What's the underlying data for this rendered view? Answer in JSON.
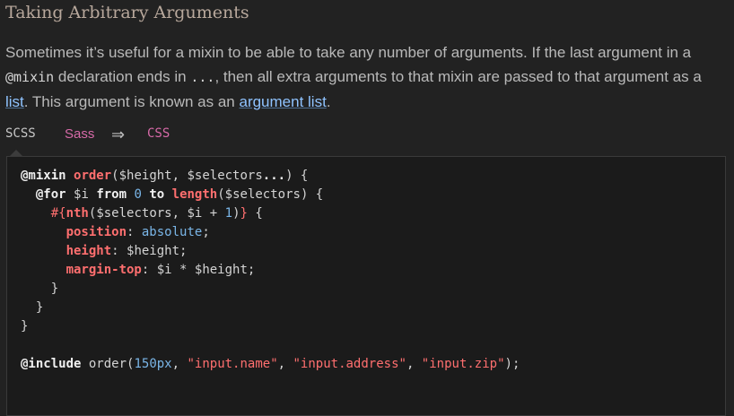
{
  "heading": "Taking Arbitrary Arguments",
  "paragraph": {
    "t1": "Sometimes it’s useful for a mixin to be able to take any number of arguments. If the last argument in a ",
    "code1": "@mixin",
    "t2": " declaration ends in ",
    "code2": "...",
    "t3": ", then all extra arguments to that mixin are passed to that argument as a ",
    "link1": "list",
    "t4": ". This argument is known as an ",
    "link2": "argument list",
    "t5": "."
  },
  "tabs": {
    "scss": "SCSS",
    "sass": "Sass",
    "arrow": "⇒",
    "css": "CSS",
    "active": "SCSS"
  },
  "code": {
    "line1": {
      "kw": "@mixin",
      "name": "order",
      "open": "(",
      "a1": "$height",
      "sep": ", ",
      "a2": "$selectors",
      "dots": "...",
      "close": ") {"
    },
    "line2": {
      "kw": "@for",
      "var": "$i",
      "from": "from",
      "n0": "0",
      "to": "to",
      "fn": "length",
      "open": "(",
      "arg": "$selectors",
      "close": ") {"
    },
    "line3": {
      "interp_open": "#{",
      "fn": "nth",
      "open": "(",
      "a1": "$selectors",
      "sep": ", ",
      "a2": "$i",
      "plus": " + ",
      "n1": "1",
      "close_fn": ")",
      "interp_close": "}",
      "brace": " {"
    },
    "line4": {
      "prop": "position",
      "colon": ": ",
      "val": "absolute",
      "semi": ";"
    },
    "line5": {
      "prop": "height",
      "colon": ": ",
      "val": "$height",
      "semi": ";"
    },
    "line6": {
      "prop": "margin-top",
      "colon": ": ",
      "v1": "$i",
      "op": " * ",
      "v2": "$height",
      "semi": ";"
    },
    "line7": "}",
    "line8": "}",
    "line9": "}",
    "line11": {
      "kw": "@include",
      "name": "order",
      "open": "(",
      "n": "150px",
      "sep": ", ",
      "s1": "\"input.name\"",
      "s2": "\"input.address\"",
      "s3": "\"input.zip\"",
      "close": ");"
    }
  },
  "colors": {
    "background": "#222222",
    "code_background": "#1b1b1b",
    "link": "#8fc3ff",
    "keyword_red": "#ff6f6f",
    "number_blue": "#7ab6e8",
    "tab_pink": "#d76aa8"
  }
}
